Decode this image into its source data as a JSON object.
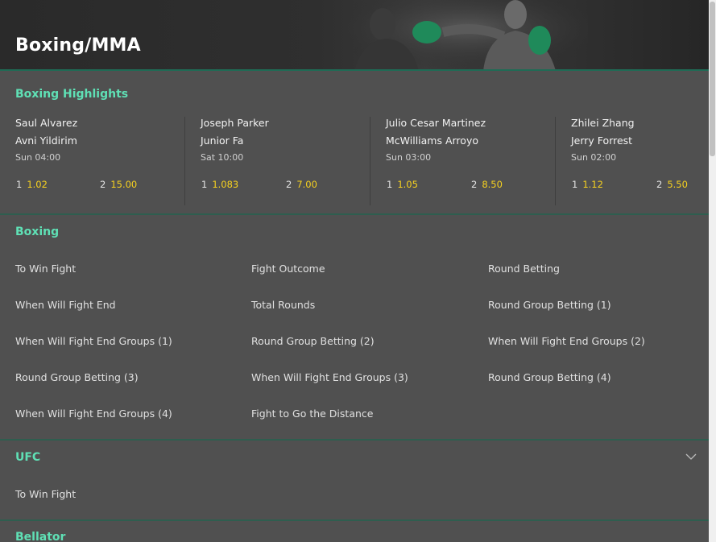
{
  "header": {
    "title": "Boxing/MMA"
  },
  "highlights": {
    "title": "Boxing Highlights",
    "events": [
      {
        "fighter1": "Saul Alvarez",
        "fighter2": "Avni Yildirim",
        "time": "Sun 04:00",
        "odd1_label": "1",
        "odd1": "1.02",
        "odd2_label": "2",
        "odd2": "15.00"
      },
      {
        "fighter1": "Joseph Parker",
        "fighter2": "Junior Fa",
        "time": "Sat 10:00",
        "odd1_label": "1",
        "odd1": "1.083",
        "odd2_label": "2",
        "odd2": "7.00"
      },
      {
        "fighter1": "Julio Cesar Martinez",
        "fighter2": "McWilliams Arroyo",
        "time": "Sun 03:00",
        "odd1_label": "1",
        "odd1": "1.05",
        "odd2_label": "2",
        "odd2": "8.50"
      },
      {
        "fighter1": "Zhilei Zhang",
        "fighter2": "Jerry Forrest",
        "time": "Sun 02:00",
        "odd1_label": "1",
        "odd1": "1.12",
        "odd2_label": "2",
        "odd2": "5.50"
      }
    ]
  },
  "boxing": {
    "title": "Boxing",
    "markets": [
      "To Win Fight",
      "Fight Outcome",
      "Round Betting",
      "When Will Fight End",
      "Total Rounds",
      "Round Group Betting (1)",
      "When Will Fight End Groups (1)",
      "Round Group Betting (2)",
      "When Will Fight End Groups (2)",
      "Round Group Betting (3)",
      "When Will Fight End Groups (3)",
      "Round Group Betting (4)",
      "When Will Fight End Groups (4)",
      "Fight to Go the Distance"
    ]
  },
  "ufc": {
    "title": "UFC",
    "markets": [
      "To Win Fight"
    ]
  },
  "bellator": {
    "title": "Bellator"
  },
  "colors": {
    "accent": "#5fe0b5",
    "odds": "#f7d21f",
    "background": "#505050"
  }
}
